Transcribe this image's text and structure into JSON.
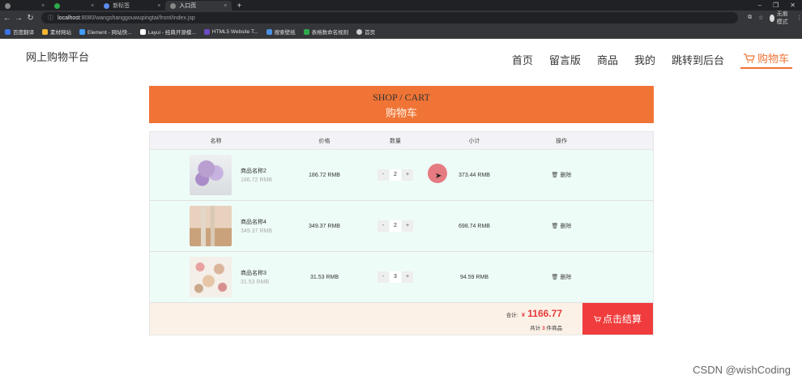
{
  "browser": {
    "tabs": [
      {
        "label": ""
      },
      {
        "label": ""
      },
      {
        "label": "新标签"
      },
      {
        "label": "入口页"
      }
    ],
    "url_host": "localhost",
    "url_rest": ":8080/wangshanggouwupingtai/front/index.jsp",
    "incognito_label": "无痕模式",
    "bookmarks": [
      {
        "label": "百度翻译",
        "color": "#3b73e6"
      },
      {
        "label": "素材网站",
        "color": "#f2b632"
      },
      {
        "label": "Element - 网站快...",
        "color": "#409eff"
      },
      {
        "label": "Layui - 经典开源模...",
        "color": "#ffffff"
      },
      {
        "label": "HTML5 Website T...",
        "color": "#6c4cc2"
      },
      {
        "label": "搜索壁纸",
        "color": "#4a90e2"
      },
      {
        "label": "表格数命名规则",
        "color": "#2eaa4a"
      },
      {
        "label": "首页",
        "color": "#cccccc"
      }
    ]
  },
  "site": {
    "brand": "网上购物平台",
    "nav": [
      {
        "label": "首页"
      },
      {
        "label": "留言版"
      },
      {
        "label": "商品"
      },
      {
        "label": "我的"
      },
      {
        "label": "跳转到后台"
      },
      {
        "label": "购物车",
        "active": true
      }
    ],
    "accent": "#f07435"
  },
  "banner": {
    "en": "SHOP / CART",
    "cn": "购物车"
  },
  "cart": {
    "headers": {
      "name": "名称",
      "price": "价格",
      "qty": "数量",
      "subtotal": "小计",
      "op": "操作"
    },
    "rows": [
      {
        "name": "商品名称2",
        "unit": "186.72 RMB",
        "price": "186.72 RMB",
        "qty": "2",
        "subtotal": "373.44 RMB",
        "op": "删除",
        "minus": "-",
        "plus": "+"
      },
      {
        "name": "商品名称4",
        "unit": "349.37 RMB",
        "price": "349.37 RMB",
        "qty": "2",
        "subtotal": "698.74 RMB",
        "op": "删除",
        "minus": "-",
        "plus": "+"
      },
      {
        "name": "商品名称3",
        "unit": "31.53 RMB",
        "price": "31.53 RMB",
        "qty": "3",
        "subtotal": "94.59 RMB",
        "op": "删除",
        "minus": "-",
        "plus": "+"
      }
    ],
    "total_label": "合计:",
    "currency": "¥",
    "total": "1166.77",
    "count_pre": "共计",
    "count": "3",
    "count_post": "件商品",
    "checkout": "点击结算"
  },
  "watermark": "CSDN @wishCoding"
}
